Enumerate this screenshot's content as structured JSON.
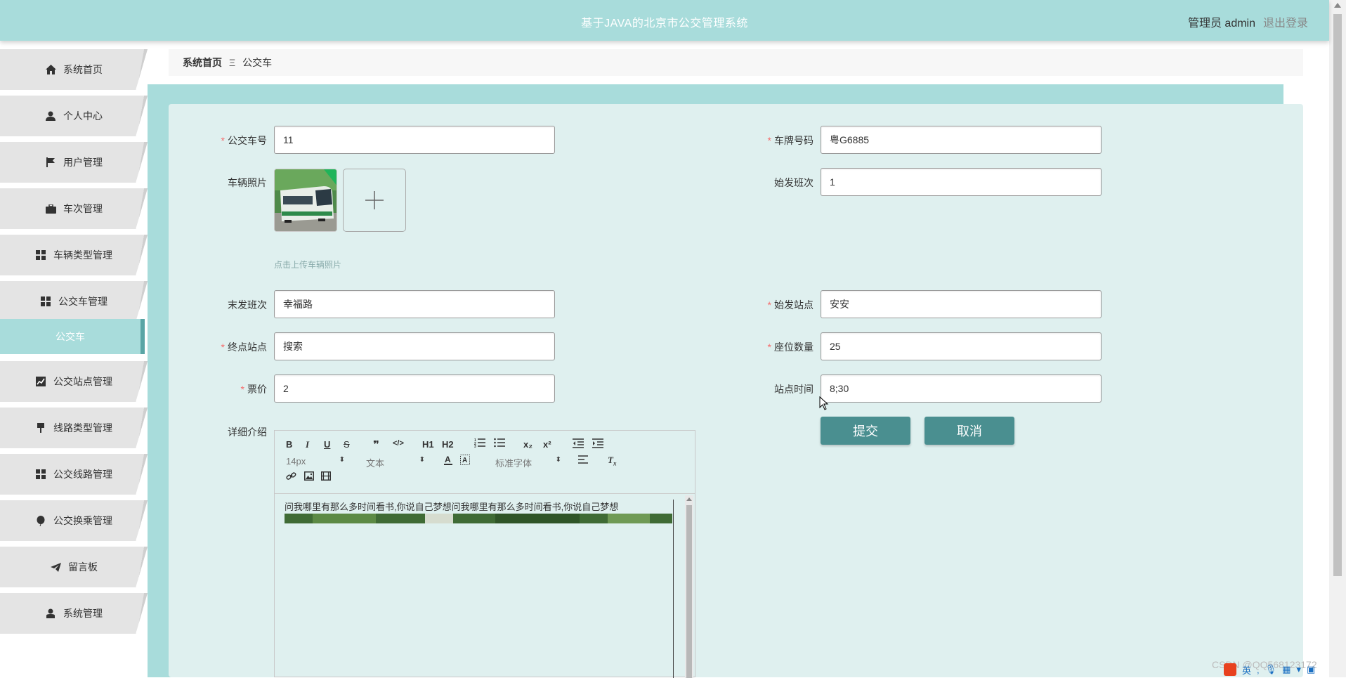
{
  "header": {
    "title": "基于JAVA的北京市公交管理系统",
    "user": "管理员 admin",
    "logout": "退出登录"
  },
  "sidebar": {
    "items": [
      {
        "label": "系统首页",
        "icon": "home-icon"
      },
      {
        "label": "个人中心",
        "icon": "user-icon"
      },
      {
        "label": "用户管理",
        "icon": "flag-icon"
      },
      {
        "label": "车次管理",
        "icon": "briefcase-icon"
      },
      {
        "label": "车辆类型管理",
        "icon": "grid-icon"
      },
      {
        "label": "公交车管理",
        "icon": "grid-icon"
      },
      {
        "label": "公交车",
        "icon": "",
        "active": true
      },
      {
        "label": "公交站点管理",
        "icon": "chart-icon"
      },
      {
        "label": "线路类型管理",
        "icon": "pin-icon"
      },
      {
        "label": "公交线路管理",
        "icon": "grid-icon"
      },
      {
        "label": "公交换乘管理",
        "icon": "balloon-icon"
      },
      {
        "label": "留言板",
        "icon": "send-icon"
      },
      {
        "label": "系统管理",
        "icon": "user-icon"
      }
    ]
  },
  "breadcrumb": {
    "home": "系统首页",
    "separator": "Ξ",
    "current": "公交车"
  },
  "form": {
    "bus_no": {
      "label": "公交车号",
      "value": "11",
      "required": true
    },
    "plate": {
      "label": "车牌号码",
      "value": "粤G6885",
      "required": true
    },
    "photo": {
      "label": "车辆照片",
      "hint": "点击上传车辆照片"
    },
    "first_shift": {
      "label": "始发班次",
      "value": "1",
      "required": false
    },
    "last_shift": {
      "label": "末发班次",
      "value": "幸福路",
      "required": false
    },
    "start_station": {
      "label": "始发站点",
      "value": "安安",
      "required": true
    },
    "end_station": {
      "label": "终点站点",
      "value": "搜索",
      "required": true
    },
    "seats": {
      "label": "座位数量",
      "value": "25",
      "required": true
    },
    "fare": {
      "label": "票价",
      "value": "2",
      "required": true
    },
    "station_time": {
      "label": "站点时间",
      "value": "8;30",
      "required": false
    },
    "detail": {
      "label": "详细介绍"
    },
    "submit": "提交",
    "cancel": "取消"
  },
  "editor": {
    "toolbar": {
      "bold": "B",
      "italic": "I",
      "underline": "U",
      "strike": "S",
      "quote": "❞",
      "code": "</>",
      "h1": "H1",
      "h2": "H2",
      "subscript": "x₂",
      "superscript": "x²",
      "size": "14px",
      "text_type": "文本",
      "font": "标准字体"
    },
    "content": "问我哪里有那么多时间看书,你说自己梦想问我哪里有那么多时间看书,你说自己梦想"
  },
  "watermark": "CSDN @QQ568123172",
  "tray": {
    "ime": "英"
  },
  "colors": {
    "accent": "#a8dcdb",
    "button": "#4a8f90",
    "panel": "#dff0ef",
    "required": "#f56c6c"
  }
}
